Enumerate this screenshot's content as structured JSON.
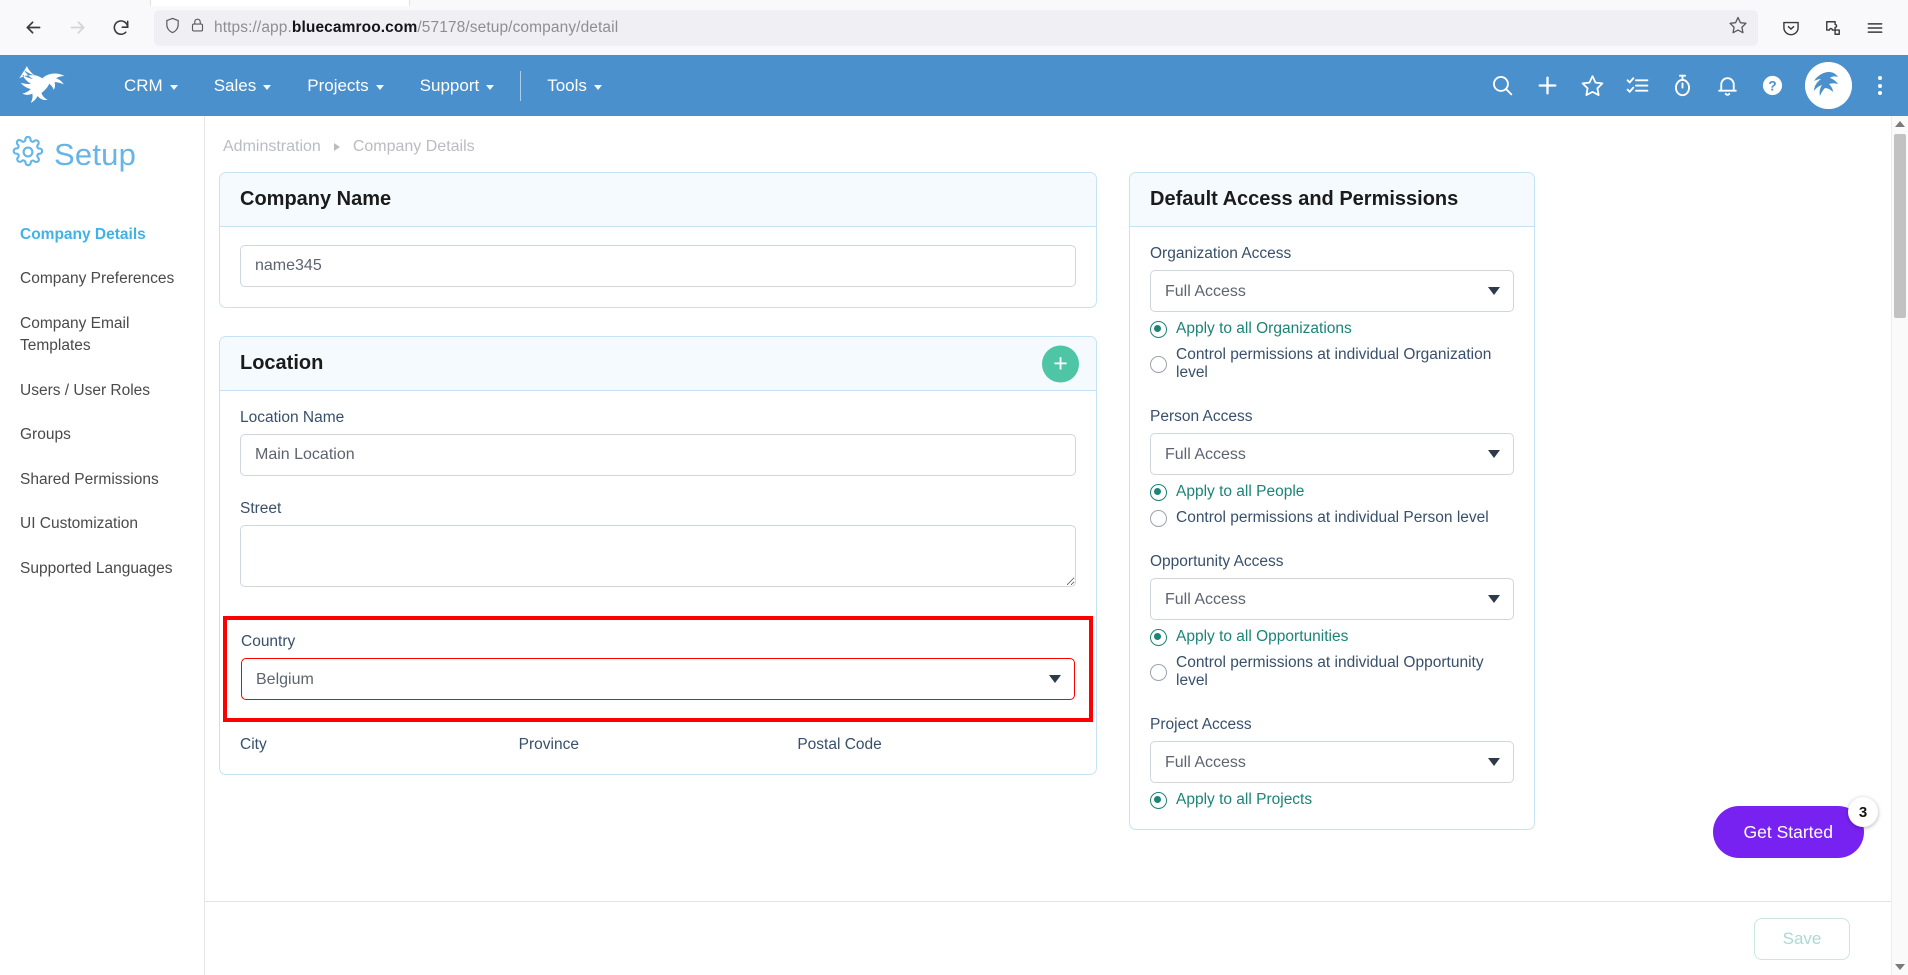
{
  "browser": {
    "back_icon": "back-arrow-icon",
    "forward_icon": "forward-arrow-icon",
    "reload_icon": "reload-icon",
    "shield_icon": "shield-icon",
    "lock_icon": "padlock-icon",
    "url_scheme": "https://",
    "url_host_pre": "app.",
    "url_host_bold": "bluecamroo.com",
    "url_path": "/57178/setup/company/detail",
    "bookmark_icon": "star-outline-icon",
    "pocket_icon": "pocket-icon",
    "extensions_icon": "extensions-icon",
    "menu_icon": "hamburger-menu-icon"
  },
  "appbar": {
    "logo": "bluecamroo-kangaroo-logo",
    "nav": [
      {
        "label": "CRM"
      },
      {
        "label": "Sales"
      },
      {
        "label": "Projects"
      },
      {
        "label": "Support"
      },
      {
        "label": "Tools"
      }
    ],
    "icons": [
      {
        "name": "search-icon"
      },
      {
        "name": "add-icon"
      },
      {
        "name": "favorites-star-icon"
      },
      {
        "name": "tasks-checklist-icon"
      },
      {
        "name": "timer-stopwatch-icon"
      },
      {
        "name": "notifications-bell-icon"
      },
      {
        "name": "help-question-icon"
      }
    ],
    "avatar": "user-avatar",
    "kebab": "more-options-icon"
  },
  "sidebar": {
    "header": "Setup",
    "header_icon": "gear-icon",
    "items": [
      {
        "label": "Company Details",
        "active": true
      },
      {
        "label": "Company Preferences",
        "active": false
      },
      {
        "label": "Company Email Templates",
        "active": false
      },
      {
        "label": "Users / User Roles",
        "active": false
      },
      {
        "label": "Groups",
        "active": false
      },
      {
        "label": "Shared Permissions",
        "active": false
      },
      {
        "label": "UI Customization",
        "active": false
      },
      {
        "label": "Supported Languages",
        "active": false
      }
    ]
  },
  "breadcrumb": {
    "root": "Adminstration",
    "current": "Company Details"
  },
  "company_name_card": {
    "title": "Company Name",
    "value": "name345"
  },
  "location_card": {
    "title": "Location",
    "add_button": "+",
    "location_name_label": "Location Name",
    "location_name_value": "Main Location",
    "street_label": "Street",
    "street_value": "",
    "country_label": "Country",
    "country_value": "Belgium",
    "country_options": [
      "Belgium"
    ],
    "city_label": "City",
    "province_label": "Province",
    "postal_code_label": "Postal Code",
    "highlight_color": "#ff0000"
  },
  "permissions_card": {
    "title": "Default Access and Permissions",
    "groups": [
      {
        "label": "Organization Access",
        "value": "Full Access",
        "options": [
          "Full Access"
        ],
        "radio_all": "Apply to all Organizations",
        "radio_individual": "Control permissions at individual Organization level",
        "selected": "all"
      },
      {
        "label": "Person Access",
        "value": "Full Access",
        "options": [
          "Full Access"
        ],
        "radio_all": "Apply to all People",
        "radio_individual": "Control permissions at individual Person level",
        "selected": "all"
      },
      {
        "label": "Opportunity Access",
        "value": "Full Access",
        "options": [
          "Full Access"
        ],
        "radio_all": "Apply to all Opportunities",
        "radio_individual": "Control permissions at individual Opportunity level",
        "selected": "all"
      },
      {
        "label": "Project Access",
        "value": "Full Access",
        "options": [
          "Full Access"
        ],
        "radio_all": "Apply to all Projects",
        "radio_individual": "",
        "selected": "all"
      }
    ]
  },
  "get_started": {
    "label": "Get Started",
    "badge": "3",
    "color": "#7722f0"
  },
  "footer": {
    "save_label": "Save"
  }
}
